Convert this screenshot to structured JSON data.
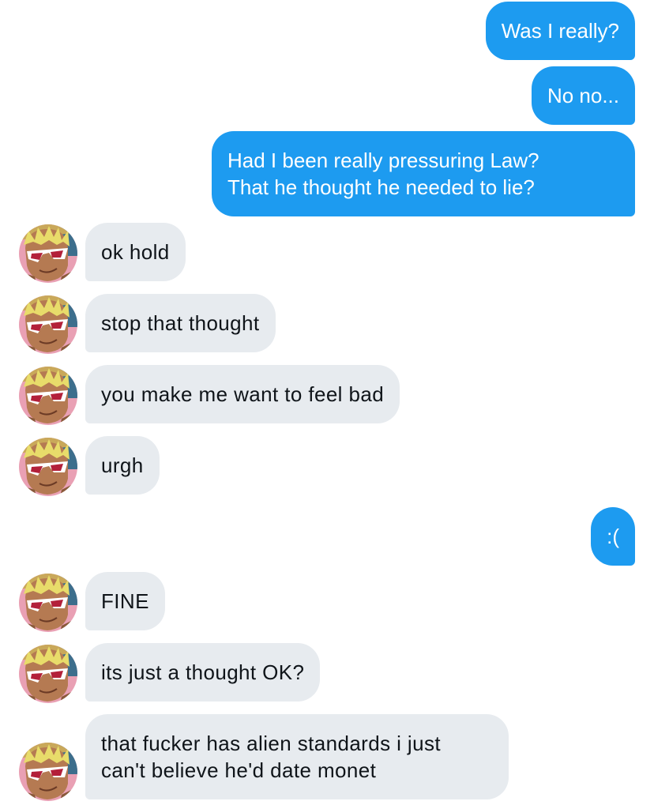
{
  "conversation": {
    "messages": [
      {
        "sender": "me",
        "text": "Was I really?"
      },
      {
        "sender": "me",
        "text": "No no..."
      },
      {
        "sender": "me",
        "lines": [
          "Had I been really pressuring Law?",
          "That he thought he needed to lie?"
        ]
      },
      {
        "sender": "them",
        "text": "ok hold"
      },
      {
        "sender": "them",
        "text": "stop that thought"
      },
      {
        "sender": "them",
        "text": "you make me want to feel bad"
      },
      {
        "sender": "them",
        "text": "urgh"
      },
      {
        "sender": "me",
        "text": ":("
      },
      {
        "sender": "them",
        "text": "FINE"
      },
      {
        "sender": "them",
        "text": "its just a thought OK?"
      },
      {
        "sender": "them",
        "lines": [
          "that fucker has alien standards i just",
          "can't believe he'd date monet"
        ]
      }
    ]
  },
  "colors": {
    "outgoing_bubble": "#1d9bf0",
    "incoming_bubble": "#e7ebef",
    "incoming_text": "#0f1419"
  }
}
